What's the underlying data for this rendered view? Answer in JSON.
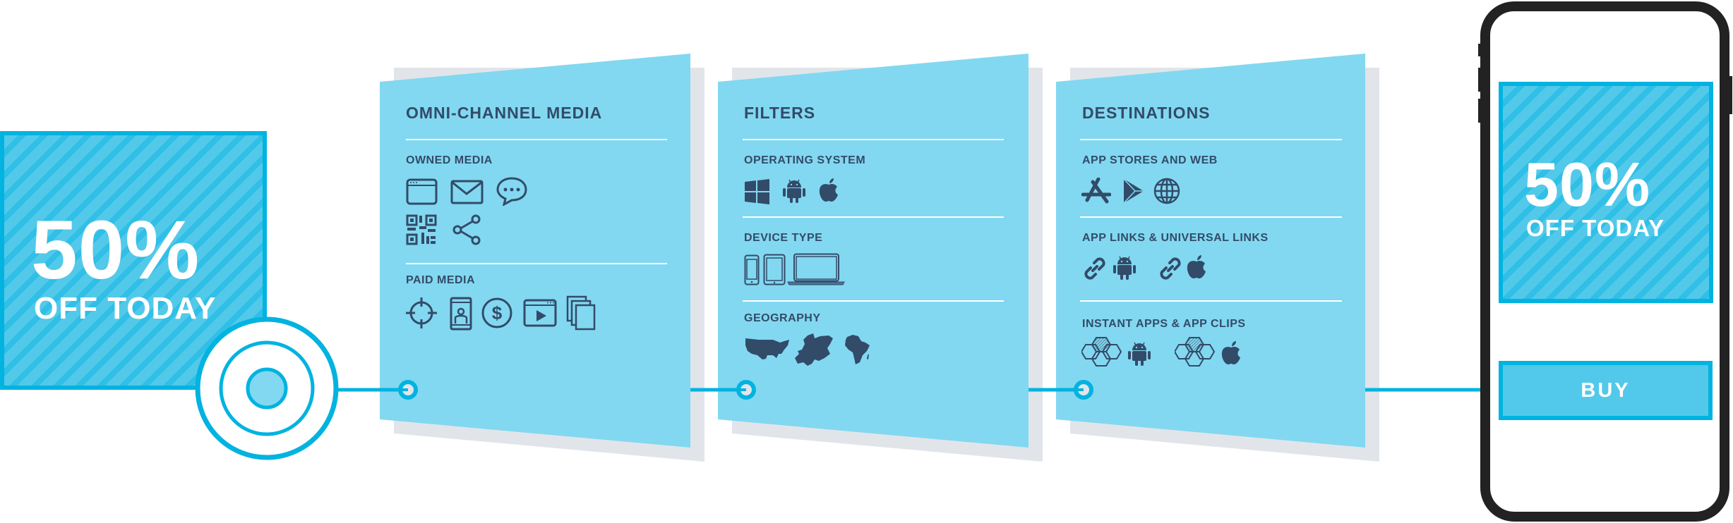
{
  "colors": {
    "accent": "#00b3e0",
    "panel": "#82d8f0",
    "panel_shadow": "#e1e5ea",
    "text_dark": "#324b69",
    "phone_frame": "#222222"
  },
  "left_banner": {
    "headline": "50%",
    "subline": "OFF TODAY"
  },
  "target": {
    "icon": "target-icon"
  },
  "panels": [
    {
      "title": "OMNI-CHANNEL MEDIA",
      "sections": [
        {
          "label": "OWNED MEDIA",
          "icons": [
            "browser-window-icon",
            "email-icon",
            "chat-bubble-icon",
            "qr-code-icon",
            "share-icon"
          ]
        },
        {
          "label": "PAID MEDIA",
          "icons": [
            "crosshair-icon",
            "mobile-ad-icon",
            "dollar-icon",
            "video-player-icon",
            "stacked-pages-icon"
          ]
        }
      ]
    },
    {
      "title": "FILTERS",
      "sections": [
        {
          "label": "OPERATING SYSTEM",
          "icons": [
            "windows-icon",
            "android-icon",
            "apple-icon"
          ]
        },
        {
          "label": "DEVICE TYPE",
          "icons": [
            "phone-icon",
            "tablet-icon",
            "laptop-icon"
          ]
        },
        {
          "label": "GEOGRAPHY",
          "icons": [
            "usa-map-icon",
            "europe-map-icon",
            "africa-map-icon"
          ]
        }
      ]
    },
    {
      "title": "DESTINATIONS",
      "sections": [
        {
          "label": "APP STORES AND WEB",
          "icons": [
            "app-store-icon",
            "google-play-icon",
            "globe-icon"
          ]
        },
        {
          "label": "APP LINKS & UNIVERSAL LINKS",
          "icons": [
            "link-icon",
            "android-icon",
            "link-icon",
            "apple-icon"
          ]
        },
        {
          "label": "INSTANT APPS & APP CLIPS",
          "icons": [
            "hexagon-cluster-icon",
            "android-icon",
            "hexagon-cluster-icon",
            "apple-icon"
          ]
        }
      ]
    }
  ],
  "phone": {
    "banner_headline": "50%",
    "banner_subline": "OFF TODAY",
    "buy_label": "BUY"
  }
}
